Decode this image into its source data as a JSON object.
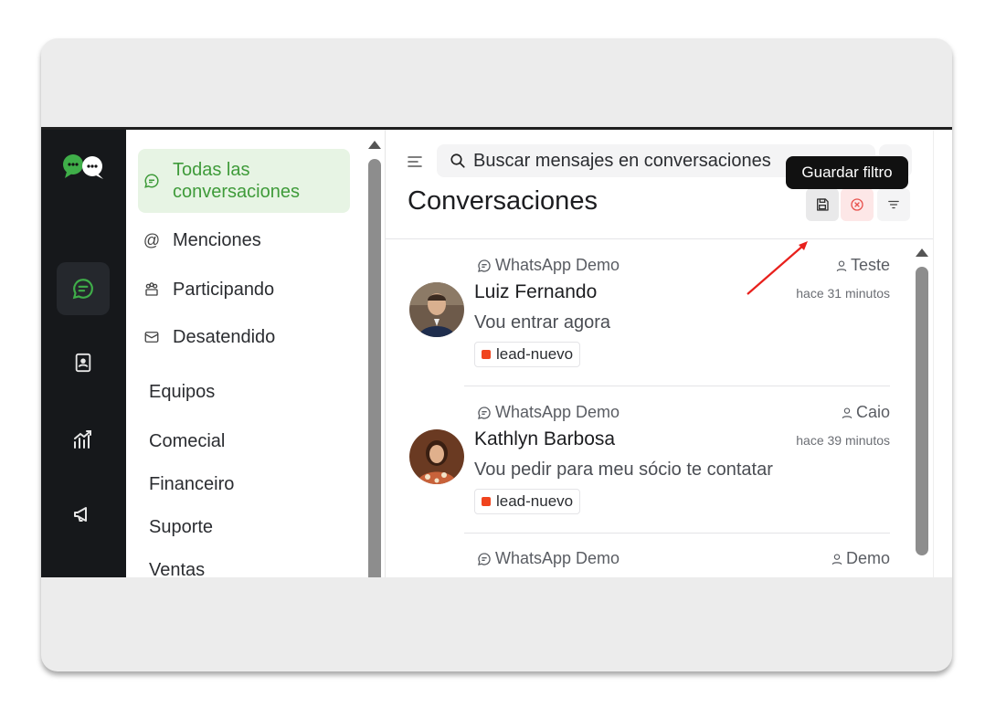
{
  "sidebar": {
    "items": [
      {
        "label": "Todas las\nconversaciones",
        "icon": "chat-bubble-icon",
        "active": true
      },
      {
        "label": "Menciones",
        "icon": "at-icon"
      },
      {
        "label": "Participando",
        "icon": "participants-icon"
      },
      {
        "label": "Desatendido",
        "icon": "envelope-icon"
      }
    ],
    "teams_title": "Equipos",
    "teams": [
      "Comecial",
      "Financeiro",
      "Suporte",
      "Ventas"
    ]
  },
  "header": {
    "search_placeholder": "Buscar mensajes en conversaciones",
    "title": "Conversaciones",
    "tooltip": "Guardar filtro"
  },
  "colors": {
    "accent": "#3f9b3a",
    "rail": "#16181b",
    "label_dot": "#f0441e",
    "clear_filter": "#e8524e"
  },
  "conversations": [
    {
      "inbox": "WhatsApp Demo",
      "agent": "Teste",
      "name": "Luiz Fernando",
      "time": "hace 31 minutos",
      "message": "Vou entrar agora",
      "label": "lead-nuevo"
    },
    {
      "inbox": "WhatsApp Demo",
      "agent": "Caio",
      "name": "Kathlyn Barbosa",
      "time": "hace 39 minutos",
      "message": "Vou pedir para meu sócio te contatar",
      "label": "lead-nuevo"
    },
    {
      "inbox": "WhatsApp Demo",
      "agent": "Demo"
    }
  ]
}
